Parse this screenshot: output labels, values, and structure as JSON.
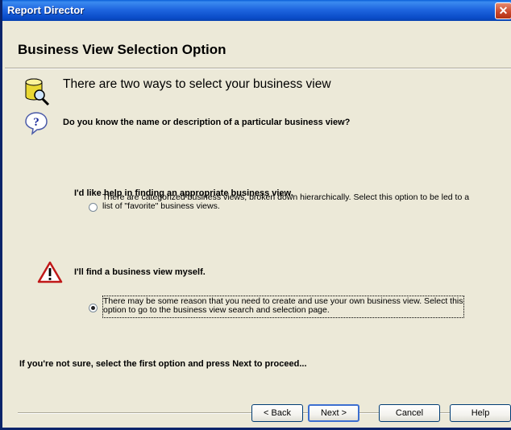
{
  "window": {
    "title": "Report Director",
    "close_symbol": "✕"
  },
  "page": {
    "heading": "Business View Selection Option",
    "intro": "There are two ways to select your business view",
    "question": "Do you know the name or description of a particular business view?"
  },
  "option1": {
    "label": "I'd like help in finding an appropriate business view.",
    "description": "There are categorized business views, broken down hierarchically.  Select this option to be led to a list of \"favorite\" business views.",
    "selected": false
  },
  "option2": {
    "label": "I'll find a business view myself.",
    "description": "There may be some reason that you need to create and use your own business view.  Select this option to go to the business view search and selection page.",
    "selected": true
  },
  "footer": {
    "hint": "If you're not sure, select the first option and press Next to proceed..."
  },
  "buttons": {
    "back": "< Back",
    "next": "Next >",
    "cancel": "Cancel",
    "help": "Help"
  },
  "icons": {
    "database": "database-search-icon",
    "question": "question-icon",
    "warning": "warning-icon"
  }
}
